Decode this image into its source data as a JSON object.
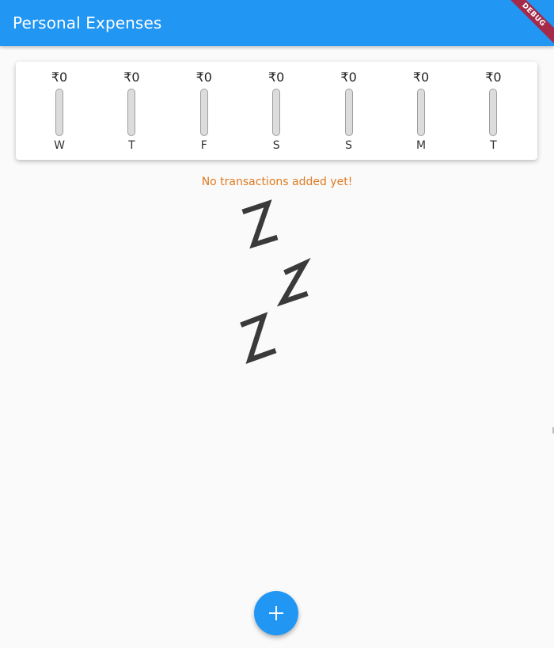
{
  "app_bar": {
    "title": "Personal Expenses",
    "debug_label": "DEBUG",
    "color": "#2196f3"
  },
  "chart": {
    "bars": [
      {
        "day": "W",
        "amount": "₹0",
        "fill_fraction": 0
      },
      {
        "day": "T",
        "amount": "₹0",
        "fill_fraction": 0
      },
      {
        "day": "F",
        "amount": "₹0",
        "fill_fraction": 0
      },
      {
        "day": "S",
        "amount": "₹0",
        "fill_fraction": 0
      },
      {
        "day": "S",
        "amount": "₹0",
        "fill_fraction": 0
      },
      {
        "day": "M",
        "amount": "₹0",
        "fill_fraction": 0
      },
      {
        "day": "T",
        "amount": "₹0",
        "fill_fraction": 0
      }
    ]
  },
  "empty_state": {
    "message": "No transactions added yet!",
    "message_color": "#e07a1f",
    "image": "sleeping-zzz-icon"
  },
  "fab": {
    "icon": "plus-icon",
    "color": "#2196f3"
  }
}
